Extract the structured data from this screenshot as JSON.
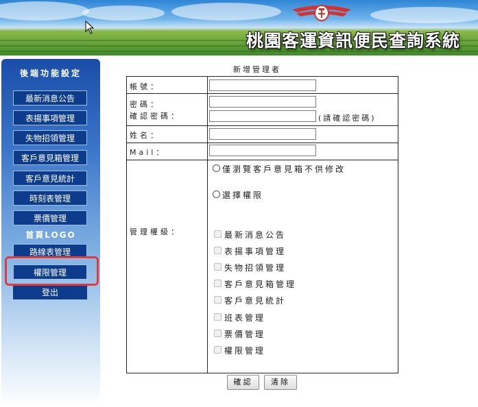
{
  "header": {
    "site_title": "桃園客運資訊便民查詢系統",
    "logo_icon": "bus-company-emblem-icon"
  },
  "sidebar": {
    "title": "後端功能設定",
    "items": [
      {
        "label": "最新消息公告"
      },
      {
        "label": "表揚事項管理"
      },
      {
        "label": "失物招領管理"
      },
      {
        "label": "客戶意見箱管理"
      },
      {
        "label": "客戶意見統計"
      },
      {
        "label": "時刻表管理"
      },
      {
        "label": "票價管理"
      }
    ],
    "logo_label": "首頁LOGO",
    "route_item": "路線表管理",
    "permission_item": "權限管理",
    "logout": "登出"
  },
  "form": {
    "title": "新增管理者",
    "account_label": "帳號：",
    "account_value": "",
    "password_label": "密碼：",
    "password_value": "",
    "confirm_label": "確認密碼：",
    "confirm_value": "",
    "confirm_hint": "(請確認密碼)",
    "name_label": "姓名：",
    "name_value": "",
    "mail_label": "Mail：",
    "mail_value": "",
    "level_label": "管理權級：",
    "radio_options": [
      {
        "label": "僅瀏覽客戶意見箱不供修改",
        "checked": false
      },
      {
        "label": "選擇權限",
        "checked": false
      }
    ],
    "permissions": [
      {
        "label": "最新消息公告",
        "checked": false
      },
      {
        "label": "表揚事項管理",
        "checked": false
      },
      {
        "label": "失物招領管理",
        "checked": false
      },
      {
        "label": "客戶意見箱管理",
        "checked": false
      },
      {
        "label": "客戶意見統計",
        "checked": false
      },
      {
        "label": "班表管理",
        "checked": false
      },
      {
        "label": "票價管理",
        "checked": false
      },
      {
        "label": "權限管理",
        "checked": false
      }
    ],
    "confirm_button": "確認",
    "clear_button": "清除"
  },
  "colors": {
    "nav_button": "#0d3c8c",
    "highlight": "#e03c3c"
  }
}
